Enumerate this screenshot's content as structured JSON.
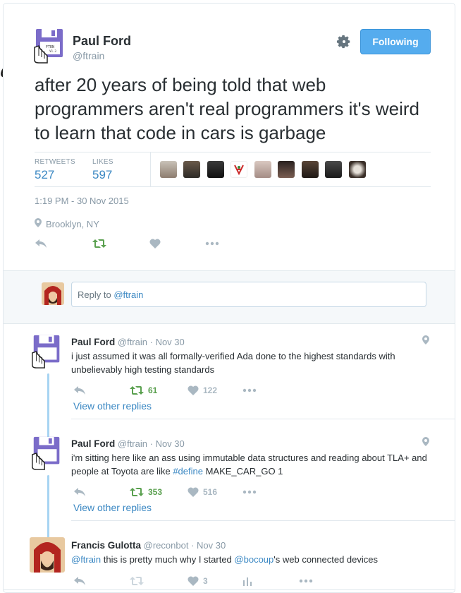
{
  "main_tweet": {
    "author_name": "Paul Ford",
    "author_handle": "@ftrain",
    "follow_label": "Following",
    "text": "after 20 years of being told that web programmers aren't real programmers it's weird to learn that code in cars is garbage",
    "retweets_label": "RETWEETS",
    "retweets_count": "527",
    "likes_label": "LIKES",
    "likes_count": "597",
    "timestamp": "1:19 PM - 30 Nov 2015",
    "location": "Brooklyn, NY",
    "icons": [
      "gear-icon",
      "reply-icon",
      "retweet-icon",
      "heart-icon",
      "more-icon",
      "pin-icon"
    ]
  },
  "stray_glyph": "a",
  "reply_box": {
    "prefix": "Reply to ",
    "mention": "@ftrain"
  },
  "replies": [
    {
      "name": "Paul Ford",
      "handle": "@ftrain",
      "date": "· Nov 30",
      "text": "i just assumed it was all formally-verified Ada done to the highest standards with unbelievably high testing standards",
      "retweets": "61",
      "likes": "122",
      "view_other": "View other replies"
    },
    {
      "name": "Paul Ford",
      "handle": "@ftrain",
      "date": "· Nov 30",
      "text_before": "i'm sitting here like an ass using immutable data structures and reading about TLA+ and people at Toyota are like ",
      "hashtag": "#define",
      "text_after": " MAKE_CAR_GO 1",
      "retweets": "353",
      "likes": "516",
      "view_other": "View other replies"
    },
    {
      "name": "Francis Gulotta",
      "handle": "@reconbot",
      "date": "· Nov 30",
      "mention1": "@ftrain",
      "text_mid": " this is pretty much why I started ",
      "mention2": "@bocoup",
      "text_after": "'s web connected devices",
      "likes": "3"
    }
  ],
  "colors": {
    "accent": "#55acee",
    "link": "#3b88c3",
    "retweet_active": "#5aa04f",
    "muted": "#8899a6",
    "thread_line": "#a7d4f2"
  }
}
